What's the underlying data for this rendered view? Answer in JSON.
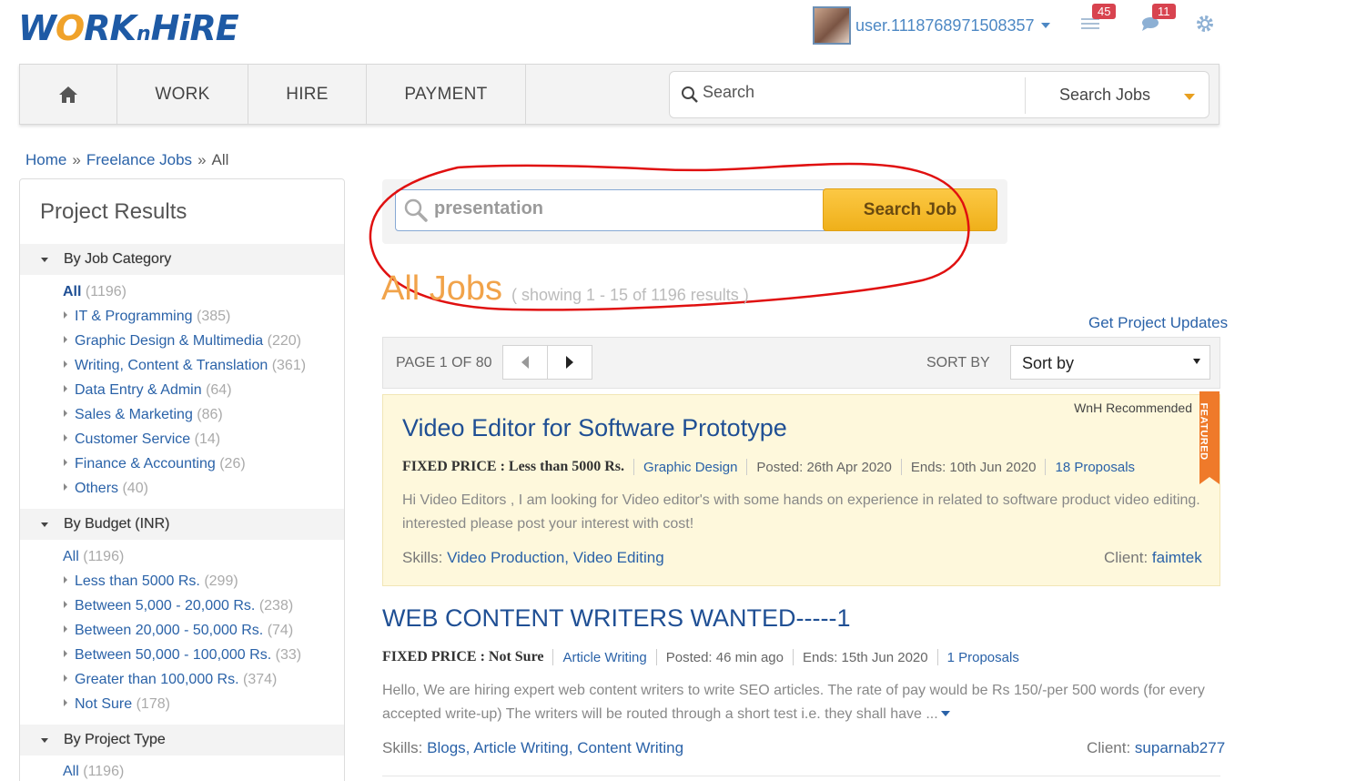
{
  "header": {
    "logo_text": "WORKnHIRE",
    "username": "user.1118768971508357",
    "notifications_count": "45",
    "messages_count": "11"
  },
  "nav": {
    "items": [
      "WORK",
      "HIRE",
      "PAYMENT"
    ],
    "search_placeholder": "Search",
    "search_scope": "Search Jobs"
  },
  "breadcrumb": [
    "Home",
    "Freelance Jobs",
    "All"
  ],
  "sidebar": {
    "title": "Project Results",
    "job_category": {
      "heading": "By Job Category",
      "items": [
        {
          "label": "All",
          "count": "(1196)"
        },
        {
          "label": "IT & Programming",
          "count": "(385)"
        },
        {
          "label": "Graphic Design & Multimedia",
          "count": "(220)"
        },
        {
          "label": "Writing, Content & Translation",
          "count": "(361)"
        },
        {
          "label": "Data Entry & Admin",
          "count": "(64)"
        },
        {
          "label": "Sales & Marketing",
          "count": "(86)"
        },
        {
          "label": "Customer Service",
          "count": "(14)"
        },
        {
          "label": "Finance & Accounting",
          "count": "(26)"
        },
        {
          "label": "Others",
          "count": "(40)"
        }
      ]
    },
    "budget": {
      "heading": "By Budget (INR)",
      "items": [
        {
          "label": "All",
          "count": "(1196)"
        },
        {
          "label": "Less than 5000 Rs.",
          "count": "(299)"
        },
        {
          "label": "Between 5,000 - 20,000 Rs.",
          "count": "(238)"
        },
        {
          "label": "Between 20,000 - 50,000 Rs.",
          "count": "(74)"
        },
        {
          "label": "Between 50,000 - 100,000 Rs.",
          "count": "(33)"
        },
        {
          "label": "Greater than 100,000 Rs.",
          "count": "(374)"
        },
        {
          "label": "Not Sure",
          "count": "(178)"
        }
      ]
    },
    "project_type": {
      "heading": "By Project Type",
      "items": [
        {
          "label": "All",
          "count": "(1196)"
        }
      ]
    }
  },
  "search": {
    "query": "presentation",
    "button_label": "Search Job"
  },
  "results": {
    "heading": "All Jobs",
    "showing": "( showing 1 - 15 of 1196 results )",
    "get_updates": "Get Project Updates",
    "page_label": "PAGE 1 OF 80",
    "sort_label": "SORT BY",
    "sort_value": "Sort by"
  },
  "jobs": [
    {
      "badge": "WnH Recommended",
      "ribbon": "FEATURED",
      "title": "Video Editor for Software Prototype",
      "price": "FIXED PRICE : Less than 5000 Rs.",
      "category": "Graphic Design",
      "posted": "Posted: 26th Apr 2020",
      "ends": "Ends: 10th Jun 2020",
      "proposals": "18 Proposals",
      "description": "Hi Video Editors , I am looking for Video editor's with some hands on experience in related to software product video editing. interested please post your interest with cost!",
      "skills_label": "Skills:",
      "skills": [
        "Video Production,",
        "Video Editing"
      ],
      "client_label": "Client:",
      "client": "faimtek"
    },
    {
      "title": "WEB CONTENT WRITERS WANTED-----1",
      "price": "FIXED PRICE : Not Sure",
      "category": "Article Writing",
      "posted": "Posted: 46 min ago",
      "ends": "Ends: 15th Jun 2020",
      "proposals": "1 Proposals",
      "description": "Hello, We are hiring expert web content writers to write SEO articles. The rate of pay would be Rs 150/-per 500 words (for every accepted write-up) The writers will be routed through a short test i.e. they shall have ...",
      "skills_label": "Skills:",
      "skills": [
        "Blogs,",
        "Article Writing,",
        "Content Writing"
      ],
      "client_label": "Client:",
      "client": "suparnab277"
    }
  ],
  "colors": {
    "brand_blue": "#1e5aa5",
    "link_blue": "#2a62a8",
    "accent_orange": "#f1a34a",
    "annotation_red": "#e01010"
  }
}
